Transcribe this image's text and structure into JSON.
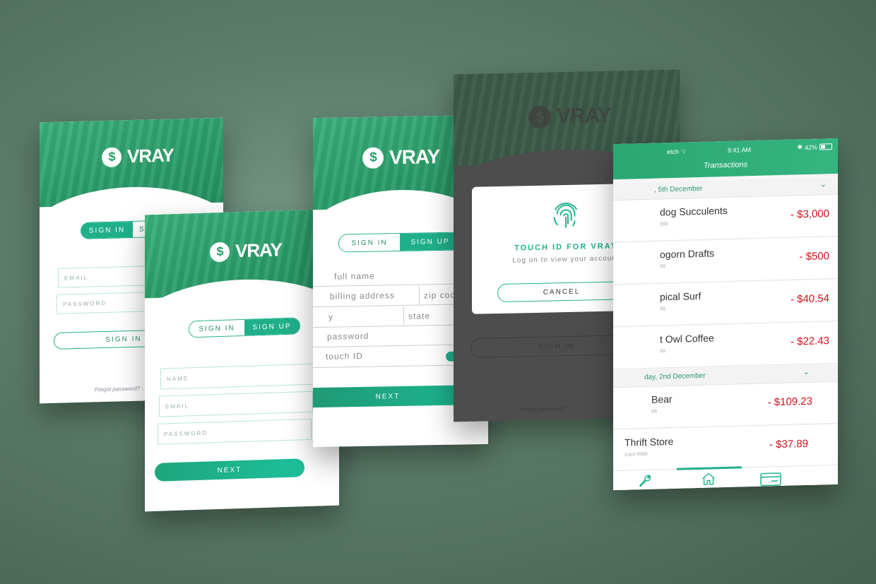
{
  "brand": "VRAY",
  "coin_symbol": "$",
  "screen1": {
    "segment": {
      "sign_in": "SIGN IN",
      "sign_up": "SIGN UP"
    },
    "email_placeholder": "EMAIL",
    "password_placeholder": "PASSWORD",
    "submit": "SIGN IN",
    "forgot": "Forgot password?"
  },
  "screen2": {
    "segment": {
      "sign_in": "SIGN IN",
      "sign_up": "SIGN UP"
    },
    "name_placeholder": "NAME",
    "email_placeholder": "EMAIL",
    "password_placeholder": "PASSWORD",
    "next": "NEXT"
  },
  "screen3": {
    "segment": {
      "sign_in": "SIGN IN",
      "sign_up": "SIGN UP"
    },
    "full_name": "full name",
    "billing_address": "billing address",
    "zip_code": "zip code",
    "city": "y",
    "state": "state",
    "password": "password",
    "touch_id": "touch ID",
    "next": "NEXT"
  },
  "screen4": {
    "dialog_title": "TOUCH ID FOR VRAY",
    "dialog_subtitle": "Log on to view your account",
    "cancel": "CANCEL",
    "sign_in": "SIGN IN",
    "forgot": "Forgot password?"
  },
  "screen5": {
    "status": {
      "carrier": "etch",
      "time": "9:41 AM",
      "battery": "42%"
    },
    "title": "Transactions",
    "days": [
      {
        "label": ", 5th December",
        "items": [
          {
            "merchant": "dog Succulents",
            "card": "999",
            "amount": "- $3,000"
          },
          {
            "merchant": "ogorn Drafts",
            "card": "99",
            "amount": "- $500"
          },
          {
            "merchant": "pical Surf",
            "card": "99",
            "amount": "- $40.54"
          },
          {
            "merchant": "t Owl Coffee",
            "card": "99",
            "amount": "- $22.43"
          }
        ]
      },
      {
        "label": "day, 2nd December",
        "items": [
          {
            "merchant": "Bear",
            "card": "99",
            "amount": "- $109.23"
          },
          {
            "merchant": "Thrift Store",
            "card": "Card 9999",
            "amount": "- $37.89"
          }
        ]
      }
    ]
  },
  "colors": {
    "accent": "#1fb08a",
    "brand_green": "#2c9e6b",
    "negative": "#d0121b",
    "dark_overlay": "#4d4d4d"
  },
  "icons": [
    "fingerprint-icon",
    "wrench-icon",
    "home-icon",
    "card-icon",
    "chevron-down-icon",
    "wifi-icon",
    "bluetooth-icon",
    "battery-icon"
  ]
}
